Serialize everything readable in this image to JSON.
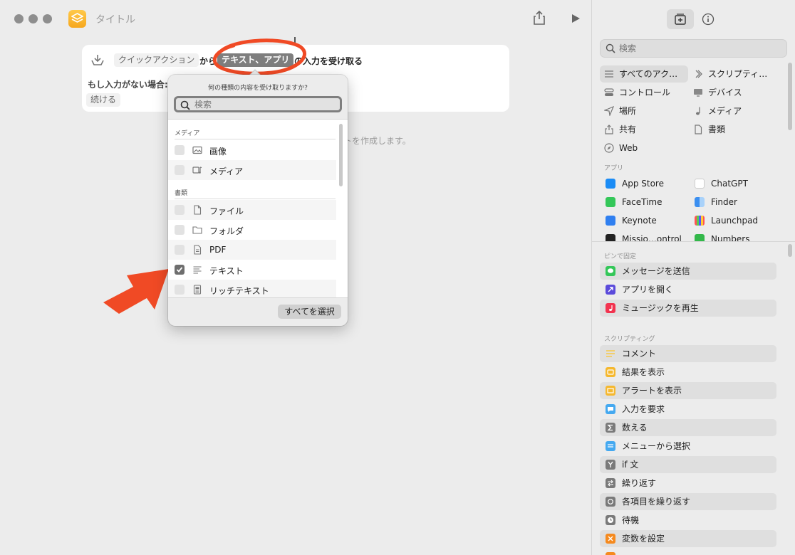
{
  "window": {
    "title": "タイトル"
  },
  "editor": {
    "trigger_label": "クイックアクション",
    "from_text": "から",
    "input_types": "テキスト、アプリ",
    "receive_text": "の入力を受け取る",
    "if_no_input_label": "もし入力がない場合:",
    "continue_label": "続ける",
    "hint_text": "トを作成します。"
  },
  "popover": {
    "title": "何の種類の内容を受け取りますか?",
    "search_placeholder": "検索",
    "sections": [
      {
        "name": "メディア",
        "items": [
          {
            "label": "画像",
            "icon": "image-icon",
            "checked": false
          },
          {
            "label": "メディア",
            "icon": "media-icon",
            "checked": false
          }
        ]
      },
      {
        "name": "書類",
        "items": [
          {
            "label": "ファイル",
            "icon": "file-icon",
            "checked": false
          },
          {
            "label": "フォルダ",
            "icon": "folder-icon",
            "checked": false
          },
          {
            "label": "PDF",
            "icon": "pdf-icon",
            "checked": false
          },
          {
            "label": "テキスト",
            "icon": "text-icon",
            "checked": true
          },
          {
            "label": "リッチテキスト",
            "icon": "rich-text-icon",
            "checked": false
          }
        ]
      }
    ],
    "select_all_label": "すべてを選択"
  },
  "sidebar": {
    "search_placeholder": "検索",
    "categories": [
      {
        "label": "すべてのアク…",
        "icon": "list-icon",
        "selected": true
      },
      {
        "label": "スクリプティ…",
        "icon": "scripting-icon",
        "selected": false
      },
      {
        "label": "コントロール",
        "icon": "control-icon",
        "selected": false
      },
      {
        "label": "デバイス",
        "icon": "device-icon",
        "selected": false
      },
      {
        "label": "場所",
        "icon": "location-icon",
        "selected": false
      },
      {
        "label": "メディア",
        "icon": "music-note-icon",
        "selected": false
      },
      {
        "label": "共有",
        "icon": "share-icon",
        "selected": false
      },
      {
        "label": "書類",
        "icon": "document-icon",
        "selected": false
      },
      {
        "label": "Web",
        "icon": "compass-icon",
        "selected": false
      }
    ],
    "apps_header": "アプリ",
    "apps": [
      {
        "label": "App Store",
        "color": "#1b8cf5"
      },
      {
        "label": "ChatGPT",
        "color": "#ffffff"
      },
      {
        "label": "FaceTime",
        "color": "#34c759"
      },
      {
        "label": "Finder",
        "color": "#3b8ff0"
      },
      {
        "label": "Keynote",
        "color": "#2f7ff0"
      },
      {
        "label": "Launchpad",
        "color": "#e8e8e8"
      },
      {
        "label": "Missio…ontrol",
        "color": "#222222"
      },
      {
        "label": "Numbers",
        "color": "#33b84a"
      }
    ],
    "pinned_header": "ピンで固定",
    "pinned": [
      {
        "label": "メッセージを送信",
        "color": "#34c759"
      },
      {
        "label": "アプリを開く",
        "color": "#5b4bdb"
      },
      {
        "label": "ミュージックを再生",
        "color": "#f2334f"
      }
    ],
    "scripting_header": "スクリプティング",
    "scripting": [
      {
        "label": "コメント",
        "color": "#f7c948"
      },
      {
        "label": "結果を表示",
        "color": "#f5b82e"
      },
      {
        "label": "アラートを表示",
        "color": "#f5b82e"
      },
      {
        "label": "入力を要求",
        "color": "#45a9f0"
      },
      {
        "label": "数える",
        "color": "#7a7a7a"
      },
      {
        "label": "メニューから選択",
        "color": "#45a9f0"
      },
      {
        "label": "if 文",
        "color": "#7a7a7a"
      },
      {
        "label": "繰り返す",
        "color": "#7a7a7a"
      },
      {
        "label": "各項目を繰り返す",
        "color": "#7a7a7a"
      },
      {
        "label": "待機",
        "color": "#7a7a7a"
      },
      {
        "label": "変数を設定",
        "color": "#f58a1f"
      }
    ]
  },
  "colors": {
    "annotation": "#f04a25",
    "accent": "#f6a71d"
  }
}
